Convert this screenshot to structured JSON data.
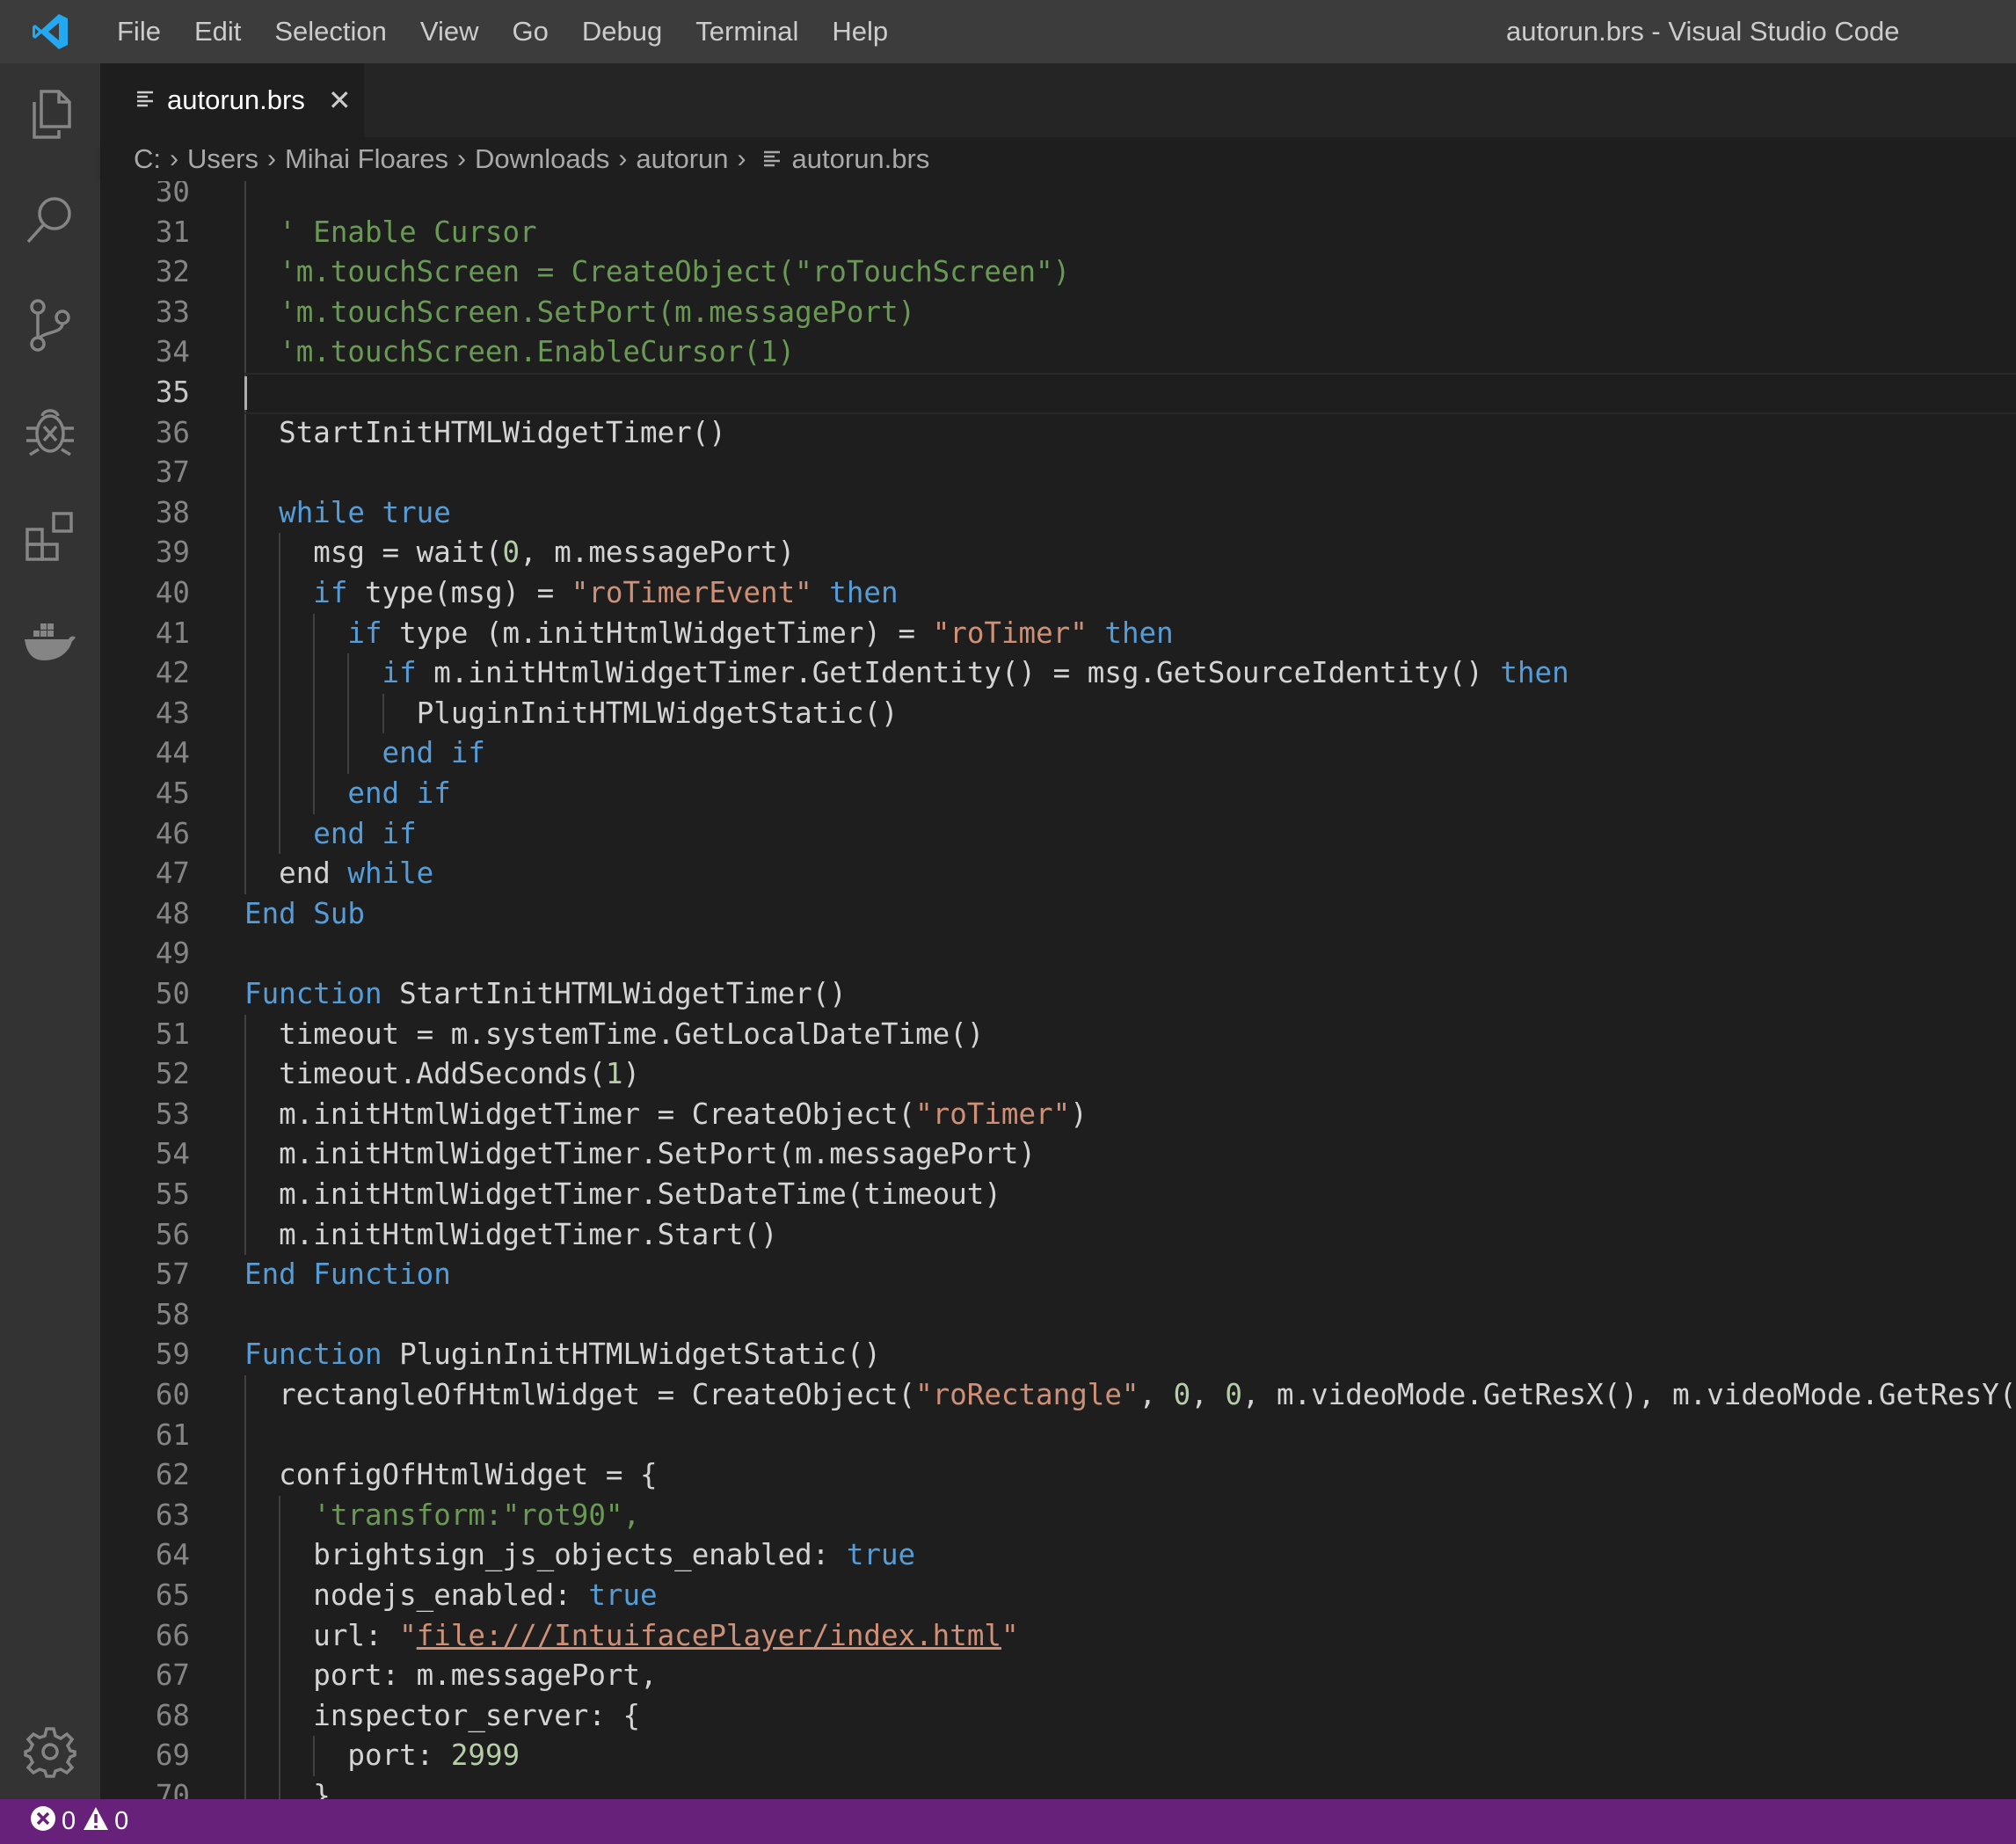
{
  "window": {
    "title": "autorun.brs - Visual Studio Code"
  },
  "menu": [
    "File",
    "Edit",
    "Selection",
    "View",
    "Go",
    "Debug",
    "Terminal",
    "Help"
  ],
  "tab": {
    "label": "autorun.brs"
  },
  "breadcrumb": [
    "C:",
    "Users",
    "Mihai Floares",
    "Downloads",
    "autorun",
    "autorun.brs"
  ],
  "editor": {
    "current_line": 35,
    "lines": [
      {
        "n": 30,
        "indent": 0,
        "tokens": []
      },
      {
        "n": 31,
        "indent": 2,
        "tokens": [
          [
            "cm",
            "' Enable Cursor"
          ]
        ]
      },
      {
        "n": 32,
        "indent": 2,
        "tokens": [
          [
            "cm",
            "'m.touchScreen = CreateObject(\"roTouchScreen\")"
          ]
        ]
      },
      {
        "n": 33,
        "indent": 2,
        "tokens": [
          [
            "cm",
            "'m.touchScreen.SetPort(m.messagePort)"
          ]
        ]
      },
      {
        "n": 34,
        "indent": 2,
        "tokens": [
          [
            "cm",
            "'m.touchScreen.EnableCursor(1)"
          ]
        ]
      },
      {
        "n": 35,
        "indent": 0,
        "tokens": []
      },
      {
        "n": 36,
        "indent": 2,
        "tokens": [
          [
            "p",
            "StartInitHTMLWidgetTimer()"
          ]
        ]
      },
      {
        "n": 37,
        "indent": 0,
        "tokens": []
      },
      {
        "n": 38,
        "indent": 2,
        "tokens": [
          [
            "kw",
            "while"
          ],
          [
            "p",
            " "
          ],
          [
            "kw",
            "true"
          ]
        ]
      },
      {
        "n": 39,
        "indent": 4,
        "tokens": [
          [
            "p",
            "msg = wait("
          ],
          [
            "num",
            "0"
          ],
          [
            "p",
            ", m.messagePort)"
          ]
        ]
      },
      {
        "n": 40,
        "indent": 4,
        "tokens": [
          [
            "kw",
            "if"
          ],
          [
            "p",
            " type(msg) = "
          ],
          [
            "str",
            "\"roTimerEvent\""
          ],
          [
            "p",
            " "
          ],
          [
            "kw",
            "then"
          ]
        ]
      },
      {
        "n": 41,
        "indent": 6,
        "tokens": [
          [
            "kw",
            "if"
          ],
          [
            "p",
            " type (m.initHtmlWidgetTimer) = "
          ],
          [
            "str",
            "\"roTimer\""
          ],
          [
            "p",
            " "
          ],
          [
            "kw",
            "then"
          ]
        ]
      },
      {
        "n": 42,
        "indent": 8,
        "tokens": [
          [
            "kw",
            "if"
          ],
          [
            "p",
            " m.initHtmlWidgetTimer.GetIdentity() = msg.GetSourceIdentity() "
          ],
          [
            "kw",
            "then"
          ]
        ]
      },
      {
        "n": 43,
        "indent": 10,
        "tokens": [
          [
            "p",
            "PluginInitHTMLWidgetStatic()"
          ]
        ]
      },
      {
        "n": 44,
        "indent": 8,
        "tokens": [
          [
            "kw",
            "end"
          ],
          [
            "p",
            " "
          ],
          [
            "kw",
            "if"
          ]
        ]
      },
      {
        "n": 45,
        "indent": 6,
        "tokens": [
          [
            "kw",
            "end"
          ],
          [
            "p",
            " "
          ],
          [
            "kw",
            "if"
          ]
        ]
      },
      {
        "n": 46,
        "indent": 4,
        "tokens": [
          [
            "kw",
            "end"
          ],
          [
            "p",
            " "
          ],
          [
            "kw",
            "if"
          ]
        ]
      },
      {
        "n": 47,
        "indent": 2,
        "tokens": [
          [
            "p",
            "end "
          ],
          [
            "kw",
            "while"
          ]
        ]
      },
      {
        "n": 48,
        "indent": 0,
        "tokens": [
          [
            "kw",
            "End"
          ],
          [
            "p",
            " "
          ],
          [
            "kw",
            "Sub"
          ]
        ]
      },
      {
        "n": 49,
        "indent": 0,
        "tokens": []
      },
      {
        "n": 50,
        "indent": 0,
        "tokens": [
          [
            "kw",
            "Function"
          ],
          [
            "p",
            " StartInitHTMLWidgetTimer()"
          ]
        ]
      },
      {
        "n": 51,
        "indent": 2,
        "tokens": [
          [
            "p",
            "timeout = m.systemTime.GetLocalDateTime()"
          ]
        ]
      },
      {
        "n": 52,
        "indent": 2,
        "tokens": [
          [
            "p",
            "timeout.AddSeconds("
          ],
          [
            "num",
            "1"
          ],
          [
            "p",
            ")"
          ]
        ]
      },
      {
        "n": 53,
        "indent": 2,
        "tokens": [
          [
            "p",
            "m.initHtmlWidgetTimer = CreateObject("
          ],
          [
            "str",
            "\"roTimer\""
          ],
          [
            "p",
            ")"
          ]
        ]
      },
      {
        "n": 54,
        "indent": 2,
        "tokens": [
          [
            "p",
            "m.initHtmlWidgetTimer.SetPort(m.messagePort)"
          ]
        ]
      },
      {
        "n": 55,
        "indent": 2,
        "tokens": [
          [
            "p",
            "m.initHtmlWidgetTimer.SetDateTime(timeout)"
          ]
        ]
      },
      {
        "n": 56,
        "indent": 2,
        "tokens": [
          [
            "p",
            "m.initHtmlWidgetTimer.Start()"
          ]
        ]
      },
      {
        "n": 57,
        "indent": 0,
        "tokens": [
          [
            "kw",
            "End"
          ],
          [
            "p",
            " "
          ],
          [
            "kw",
            "Function"
          ]
        ]
      },
      {
        "n": 58,
        "indent": 0,
        "tokens": []
      },
      {
        "n": 59,
        "indent": 0,
        "tokens": [
          [
            "kw",
            "Function"
          ],
          [
            "p",
            " PluginInitHTMLWidgetStatic()"
          ]
        ]
      },
      {
        "n": 60,
        "indent": 2,
        "tokens": [
          [
            "p",
            "rectangleOfHtmlWidget = CreateObject("
          ],
          [
            "str",
            "\"roRectangle\""
          ],
          [
            "p",
            ", "
          ],
          [
            "num",
            "0"
          ],
          [
            "p",
            ", "
          ],
          [
            "num",
            "0"
          ],
          [
            "p",
            ", m.videoMode.GetResX(), m.videoMode.GetResY())"
          ]
        ]
      },
      {
        "n": 61,
        "indent": 0,
        "tokens": []
      },
      {
        "n": 62,
        "indent": 2,
        "tokens": [
          [
            "p",
            "configOfHtmlWidget = {"
          ]
        ]
      },
      {
        "n": 63,
        "indent": 4,
        "tokens": [
          [
            "cm",
            "'transform:\"rot90\","
          ]
        ]
      },
      {
        "n": 64,
        "indent": 4,
        "tokens": [
          [
            "p",
            "brightsign_js_objects_enabled: "
          ],
          [
            "kw",
            "true"
          ]
        ]
      },
      {
        "n": 65,
        "indent": 4,
        "tokens": [
          [
            "p",
            "nodejs_enabled: "
          ],
          [
            "kw",
            "true"
          ]
        ]
      },
      {
        "n": 66,
        "indent": 4,
        "tokens": [
          [
            "p",
            "url: "
          ],
          [
            "str",
            "\""
          ],
          [
            "link",
            "file:///IntuifacePlayer/index.html"
          ],
          [
            "str",
            "\""
          ]
        ]
      },
      {
        "n": 67,
        "indent": 4,
        "tokens": [
          [
            "p",
            "port: m.messagePort,"
          ]
        ]
      },
      {
        "n": 68,
        "indent": 4,
        "tokens": [
          [
            "p",
            "inspector_server: {"
          ]
        ]
      },
      {
        "n": 69,
        "indent": 6,
        "tokens": [
          [
            "p",
            "port: "
          ],
          [
            "num",
            "2999"
          ]
        ]
      },
      {
        "n": 70,
        "indent": 4,
        "tokens": [
          [
            "p",
            "}"
          ]
        ]
      }
    ]
  },
  "status": {
    "errors": "0",
    "warnings": "0"
  },
  "colors": {
    "statusbar": "#68217a",
    "keyword": "#569cd6",
    "string": "#ce9178",
    "comment": "#6a9955",
    "number": "#b5cea8"
  }
}
